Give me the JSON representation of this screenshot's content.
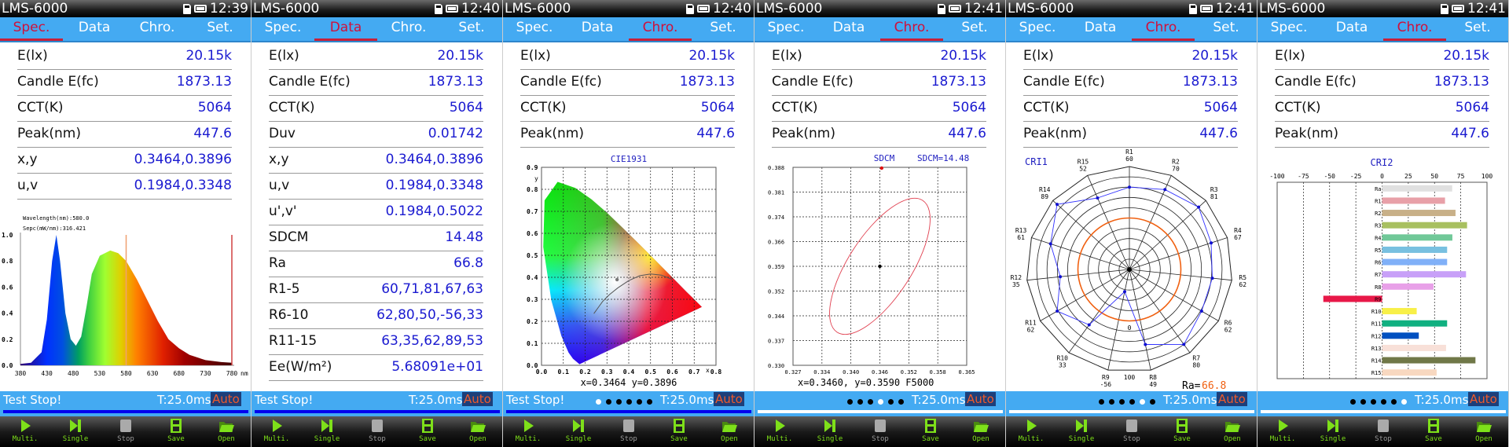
{
  "app_title": "LMS-6000",
  "tabs": [
    "Spec.",
    "Data",
    "Chro.",
    "Set."
  ],
  "status": {
    "stopped_text": "Test Stop!",
    "integration_time": "T:25.0ms",
    "mode": "Auto"
  },
  "toolbar": [
    {
      "label": "Multi.",
      "icon": "play-icon"
    },
    {
      "label": "Single",
      "icon": "step-icon"
    },
    {
      "label": "Stop",
      "icon": "stop-icon"
    },
    {
      "label": "Save",
      "icon": "save-icon"
    },
    {
      "label": "Open",
      "icon": "folder-open-icon"
    }
  ],
  "colors": {
    "tab_bar": "#44aaf2",
    "active_tab": "#d0103a",
    "value_text": "#1a1ad0",
    "button_green": "#7ee01a",
    "auto_text": "#ee5a2a"
  },
  "panels": [
    {
      "time": "12:39",
      "active_tab": 0,
      "status_text": "Test Stop!",
      "page_dot": null,
      "progress_color": "#0000ee",
      "rows": [
        {
          "label": "E(lx)",
          "value": "20.15k"
        },
        {
          "label": "Candle E(fc)",
          "value": "1873.13"
        },
        {
          "label": "CCT(K)",
          "value": "5064"
        },
        {
          "label": "Peak(nm)",
          "value": "447.6"
        },
        {
          "label": "x,y",
          "value": "0.3464,0.3896"
        },
        {
          "label": "u,v",
          "value": "0.1984,0.3348"
        }
      ]
    },
    {
      "time": "12:40",
      "active_tab": 1,
      "status_text": "Test Stop!",
      "page_dot": null,
      "progress_color": "#0000ee",
      "rows": [
        {
          "label": "E(lx)",
          "value": "20.15k"
        },
        {
          "label": "Candle E(fc)",
          "value": "1873.13"
        },
        {
          "label": "CCT(K)",
          "value": "5064"
        },
        {
          "label": "Duv",
          "value": "0.01742"
        },
        {
          "label": "x,y",
          "value": "0.3464,0.3896"
        },
        {
          "label": "u,v",
          "value": "0.1984,0.3348"
        },
        {
          "label": "u',v'",
          "value": "0.1984,0.5022"
        },
        {
          "label": "SDCM",
          "value": "14.48"
        },
        {
          "label": "Ra",
          "value": "66.8"
        },
        {
          "label": "R1-5",
          "value": "60,71,81,67,63"
        },
        {
          "label": "R6-10",
          "value": "62,80,50,-56,33"
        },
        {
          "label": "R11-15",
          "value": "63,35,62,89,53"
        },
        {
          "label": "Ee(W/m²)",
          "value": "5.68091e+01"
        }
      ]
    },
    {
      "time": "12:40",
      "active_tab": 2,
      "status_text": "Test Stop!",
      "page_dot": 0,
      "progress_color": "#0000ee",
      "rows": [
        {
          "label": "E(lx)",
          "value": "20.15k"
        },
        {
          "label": "Candle E(fc)",
          "value": "1873.13"
        },
        {
          "label": "CCT(K)",
          "value": "5064"
        },
        {
          "label": "Peak(nm)",
          "value": "447.6"
        }
      ]
    },
    {
      "time": "12:41",
      "active_tab": 2,
      "status_text": "",
      "page_dot": 3,
      "progress_color": "#ffffff",
      "rows": [
        {
          "label": "E(lx)",
          "value": "20.15k"
        },
        {
          "label": "Candle E(fc)",
          "value": "1873.13"
        },
        {
          "label": "CCT(K)",
          "value": "5064"
        },
        {
          "label": "Peak(nm)",
          "value": "447.6"
        }
      ]
    },
    {
      "time": "12:41",
      "active_tab": 2,
      "status_text": "",
      "page_dot": 4,
      "progress_color": "#ffffff",
      "rows": [
        {
          "label": "E(lx)",
          "value": "20.15k"
        },
        {
          "label": "Candle E(fc)",
          "value": "1873.13"
        },
        {
          "label": "CCT(K)",
          "value": "5064"
        },
        {
          "label": "Peak(nm)",
          "value": "447.6"
        }
      ]
    },
    {
      "time": "12:41",
      "active_tab": 2,
      "status_text": "",
      "page_dot": 5,
      "progress_color": "#ffffff",
      "rows": [
        {
          "label": "E(lx)",
          "value": "20.15k"
        },
        {
          "label": "Candle E(fc)",
          "value": "1873.13"
        },
        {
          "label": "CCT(K)",
          "value": "5064"
        },
        {
          "label": "Peak(nm)",
          "value": "447.6"
        }
      ]
    }
  ],
  "chart_data": [
    {
      "type": "area",
      "panel": 0,
      "cursor_wavelength": "Wavelength(nm):580.0",
      "cursor_spec": "Sepc(mW/nm):316.421",
      "x_unit": "nm",
      "xlim": [
        380,
        780
      ],
      "ylim": [
        0,
        1.0
      ],
      "x_ticks": [
        380,
        430,
        480,
        530,
        580,
        630,
        680,
        730,
        780
      ],
      "y_ticks": [
        "0.0",
        "0.2",
        "0.4",
        "0.6",
        "0.8",
        "1.0"
      ],
      "cursor_x": 580,
      "x": [
        380,
        400,
        420,
        430,
        440,
        448,
        455,
        465,
        475,
        485,
        495,
        505,
        515,
        530,
        550,
        565,
        580,
        600,
        620,
        640,
        660,
        680,
        700,
        730,
        760,
        780
      ],
      "y": [
        0.01,
        0.02,
        0.1,
        0.35,
        0.8,
        1.0,
        0.8,
        0.4,
        0.2,
        0.15,
        0.22,
        0.45,
        0.7,
        0.84,
        0.88,
        0.86,
        0.8,
        0.66,
        0.5,
        0.34,
        0.2,
        0.13,
        0.08,
        0.04,
        0.025,
        0.02
      ]
    },
    {
      "type": "scatter",
      "panel": 2,
      "title": "CIE1931",
      "xlabel": "x",
      "ylabel": "y",
      "xlim": [
        0,
        0.8
      ],
      "ylim": [
        0,
        0.9
      ],
      "x_ticks": [
        "0.0",
        "0.1",
        "0.2",
        "0.3",
        "0.4",
        "0.5",
        "0.6",
        "0.7",
        "0.8"
      ],
      "y_ticks": [
        "0.0",
        "0.1",
        "0.2",
        "0.3",
        "0.4",
        "0.5",
        "0.6",
        "0.7",
        "0.8",
        "0.9"
      ],
      "point": [
        0.3464,
        0.3896
      ],
      "readout": "x=0.3464  y=0.3896"
    },
    {
      "type": "scatter",
      "panel": 3,
      "title": "SDCM",
      "sdcm_label": "SDCM=14.48",
      "xlim": [
        0.327,
        0.365
      ],
      "ylim": [
        0.33,
        0.388
      ],
      "x_ticks": [
        "0.327",
        "0.334",
        "0.340",
        "0.346",
        "0.352",
        "0.358",
        "0.365"
      ],
      "y_ticks": [
        "0.330",
        "0.337",
        "0.344",
        "0.352",
        "0.359",
        "0.366",
        "0.374",
        "0.381",
        "0.388"
      ],
      "center": [
        0.346,
        0.359
      ],
      "measured": [
        0.3464,
        0.3896
      ],
      "readout": "x=0.3460, y=0.3590  F5000"
    },
    {
      "type": "radar",
      "panel": 4,
      "title": "CRI1",
      "rlim": [
        -100,
        100
      ],
      "zero_label": "0",
      "max_label": "100",
      "ra_label": "Ra=",
      "ra_value": "66.8",
      "categories": [
        "R1",
        "R2",
        "R3",
        "R4",
        "R5",
        "R6",
        "R7",
        "R8",
        "R9",
        "R10",
        "R11",
        "R12",
        "R13",
        "R14",
        "R15"
      ],
      "values": [
        60,
        70,
        81,
        67,
        62,
        62,
        80,
        49,
        -56,
        33,
        62,
        35,
        61,
        89,
        52
      ]
    },
    {
      "type": "bar",
      "panel": 5,
      "title": "CRI2",
      "xlim": [
        -100,
        100
      ],
      "x_ticks": [
        "-100",
        "-75",
        "-50",
        "-25",
        "0",
        "25",
        "50",
        "75",
        "100"
      ],
      "categories": [
        "Ra",
        "R1",
        "R2",
        "R3",
        "R4",
        "R5",
        "R6",
        "R7",
        "R8",
        "R9",
        "R10",
        "R11",
        "R12",
        "R13",
        "R14",
        "R15"
      ],
      "values": [
        66.8,
        60,
        70,
        81,
        67,
        62,
        62,
        80,
        49,
        -56,
        33,
        62,
        35,
        61,
        89,
        52
      ],
      "colors": [
        "#e0e0e0",
        "#e8a0a8",
        "#c8b088",
        "#a8c060",
        "#70c898",
        "#78c0e0",
        "#80b0f8",
        "#c8a0f8",
        "#e8a0e8",
        "#e81848",
        "#f8f048",
        "#10b080",
        "#0050c0",
        "#f8e0d8",
        "#707848",
        "#f8d8c0"
      ]
    }
  ]
}
